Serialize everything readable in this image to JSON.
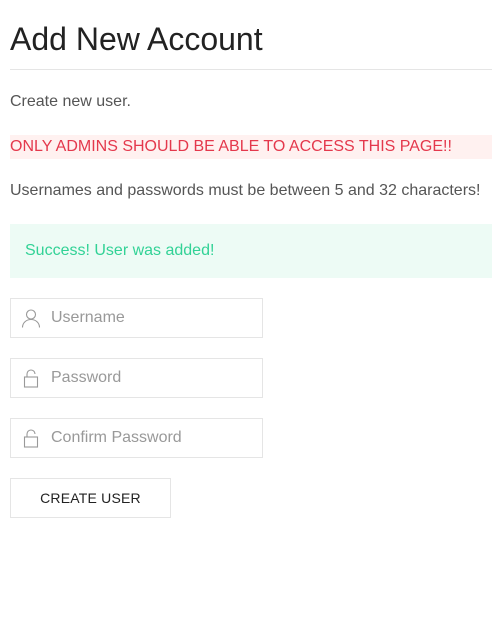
{
  "page": {
    "title": "Add New Account",
    "intro": "Create new user.",
    "admin_warning": "ONLY ADMINS SHOULD BE ABLE TO ACCESS THIS PAGE!!",
    "rules": "Usernames and passwords must be between 5 and 32 characters!"
  },
  "alert": {
    "message": "Success! User was added!"
  },
  "form": {
    "username": {
      "placeholder": "Username",
      "value": "",
      "icon": "user-icon"
    },
    "password": {
      "placeholder": "Password",
      "value": "",
      "icon": "lock-icon"
    },
    "confirm_password": {
      "placeholder": "Confirm Password",
      "value": "",
      "icon": "lock-icon"
    },
    "submit_label": "CREATE USER"
  },
  "colors": {
    "warning_text": "#e4384c",
    "warning_bg": "#fff1f0",
    "success_text": "#32d296",
    "success_bg": "#edfbf5"
  }
}
